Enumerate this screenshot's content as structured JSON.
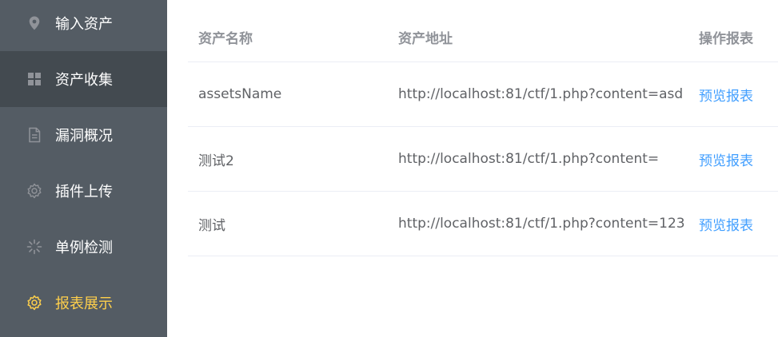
{
  "sidebar": {
    "items": [
      {
        "label": "输入资产",
        "icon": "map-pin-icon"
      },
      {
        "label": "资产收集",
        "icon": "grid-icon"
      },
      {
        "label": "漏洞概况",
        "icon": "document-icon"
      },
      {
        "label": "插件上传",
        "icon": "gear-icon"
      },
      {
        "label": "单例检测",
        "icon": "loading-icon"
      },
      {
        "label": "报表展示",
        "icon": "gear-icon"
      }
    ],
    "colors": {
      "background": "#545c64",
      "hover": "#434a50",
      "active_text": "#ffd04b"
    }
  },
  "table": {
    "headers": {
      "name": "资产名称",
      "address": "资产地址",
      "operation": "操作报表"
    },
    "rows": [
      {
        "name": "assetsName",
        "address": "http://localhost:81/ctf/1.php?content=asd",
        "action": "预览报表"
      },
      {
        "name": "测试2",
        "address": "http://localhost:81/ctf/1.php?content=",
        "action": "预览报表"
      },
      {
        "name": "测试",
        "address": "http://localhost:81/ctf/1.php?content=123",
        "action": "预览报表"
      }
    ],
    "colors": {
      "link": "#409eff",
      "text": "#606266",
      "header": "#909399"
    }
  }
}
